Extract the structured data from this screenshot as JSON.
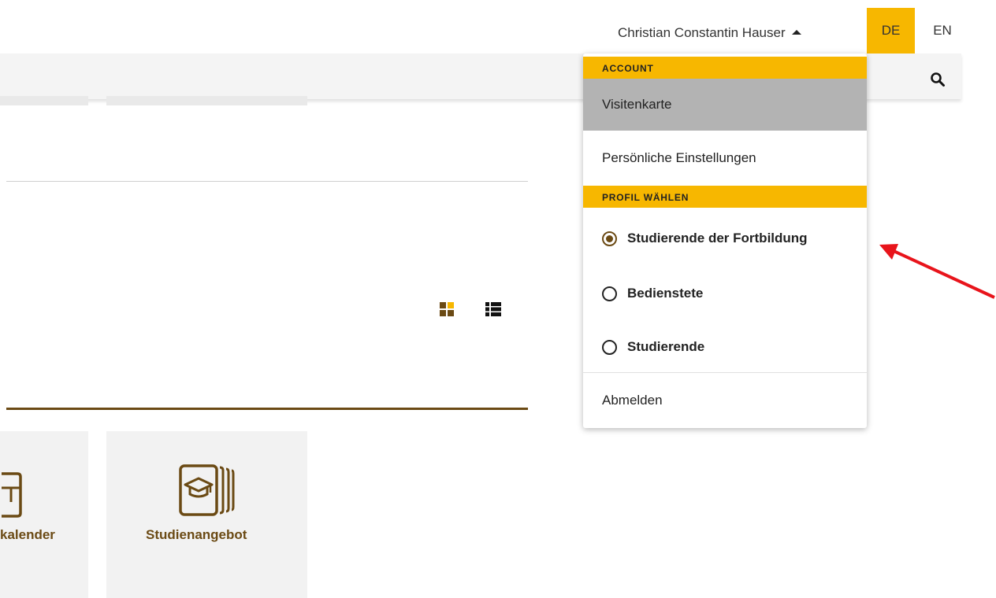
{
  "header": {
    "user_name": "Christian Constantin Hauser",
    "lang_de": "DE",
    "lang_en": "EN"
  },
  "icons": {
    "search": "search-icon",
    "grid_view": "grid-view-icon",
    "list_view": "list-view-icon",
    "study_offer": "graduation-cap-icon",
    "calendar": "calendar-icon",
    "user_menu_caret": "caret-up-icon"
  },
  "colors": {
    "accent": "#f7b700",
    "brand_brown": "#6b4a14",
    "active_item": "#b3b3b3",
    "annotation_arrow": "#e8141b"
  },
  "tiles": [
    {
      "label": "kalender"
    },
    {
      "label": "Studienangebot"
    }
  ],
  "dropdown": {
    "account_header": "ACCOUNT",
    "visitenkarte": "Visitenkarte",
    "settings": "Persönliche Einstellungen",
    "profile_header": "PROFIL WÄHLEN",
    "profiles": [
      {
        "label": "Studierende der Fortbildung",
        "selected": true
      },
      {
        "label": "Bedienstete",
        "selected": false
      },
      {
        "label": "Studierende",
        "selected": false
      }
    ],
    "logout": "Abmelden"
  }
}
